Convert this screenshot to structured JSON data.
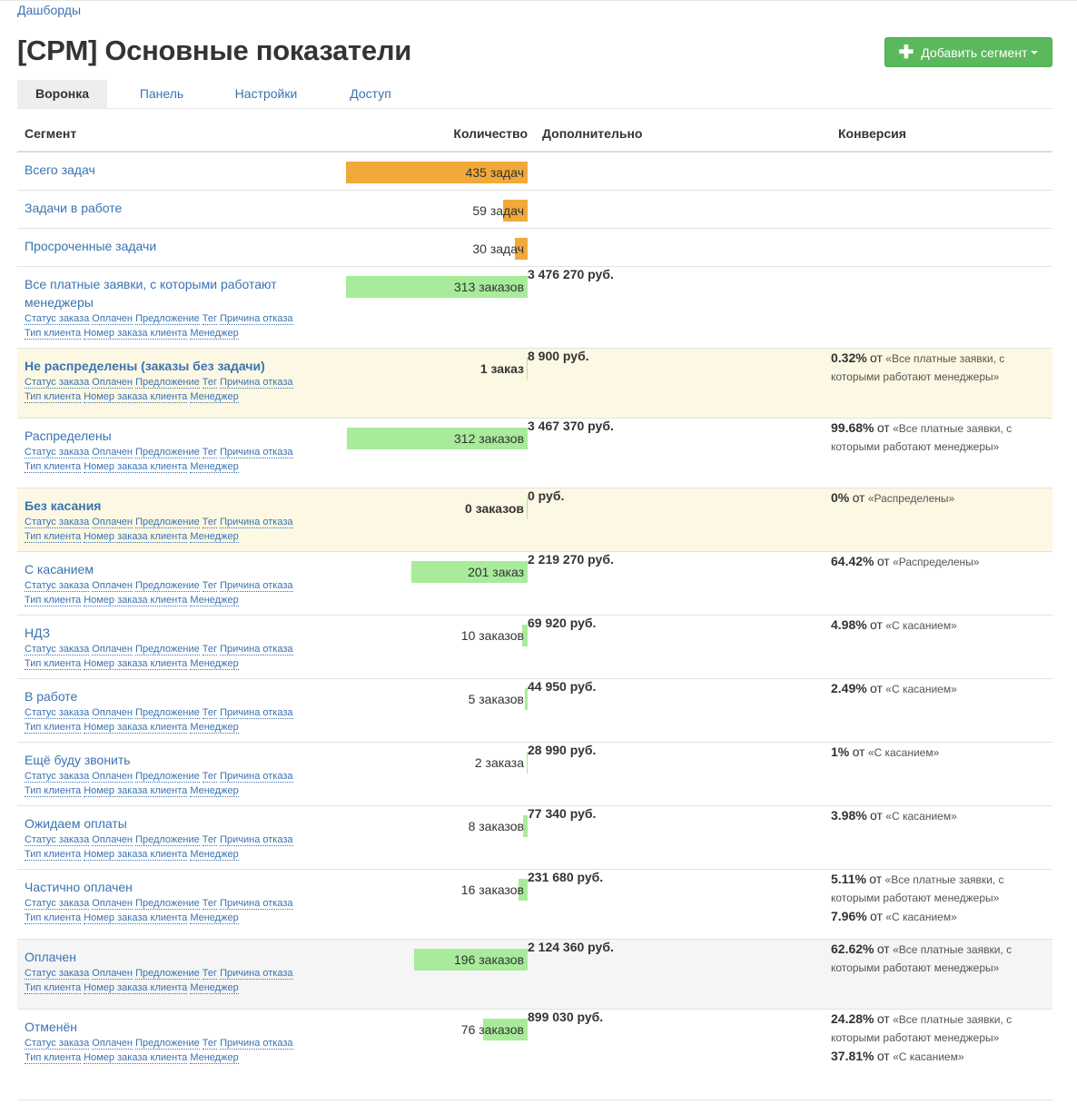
{
  "breadcrumb": "Дашборды",
  "title": "[CPM] Основные показатели",
  "add_segment_label": "Добавить сегмент",
  "tabs": [
    {
      "label": "Воронка",
      "active": true
    },
    {
      "label": "Панель",
      "active": false
    },
    {
      "label": "Настройки",
      "active": false
    },
    {
      "label": "Доступ",
      "active": false
    }
  ],
  "columns": {
    "segment": "Сегмент",
    "quantity": "Количество",
    "additional": "Дополнительно",
    "conversion": "Конверсия"
  },
  "filter_lines": [
    [
      "Статус заказа",
      "Оплачен",
      "Предложение",
      "Тег",
      "Причина отказа"
    ],
    [
      "Тип клиента",
      "Номер заказа клиента",
      "Менеджер"
    ]
  ],
  "colors": {
    "link": "#3a73b3",
    "orange_bar": "#f0a93a",
    "green_bar": "#a8eb9a",
    "highlight_row": "#fcf8e3",
    "grey_row": "#f5f5f5",
    "button": "#5cb85c"
  },
  "conversion_from_word": "от",
  "rows": [
    {
      "name": "Всего задач",
      "qty": "435 задач",
      "bar_fraction": 1.0,
      "bar_color": "orange",
      "sum": "",
      "conversion": [],
      "filters": false,
      "bold": false,
      "row_style": "normal"
    },
    {
      "name": "Задачи в работе",
      "qty": "59 задач",
      "bar_fraction": 0.136,
      "bar_color": "orange",
      "sum": "",
      "conversion": [],
      "filters": false,
      "bold": false,
      "row_style": "normal"
    },
    {
      "name": "Просроченные задачи",
      "qty": "30 задач",
      "bar_fraction": 0.069,
      "bar_color": "orange",
      "sum": "",
      "conversion": [],
      "filters": false,
      "bold": false,
      "row_style": "normal"
    },
    {
      "name": "Все платные заявки, с которыми работают менеджеры",
      "qty": "313 заказов",
      "bar_fraction": 1.0,
      "bar_color": "green",
      "sum": "3 476 270 руб.",
      "conversion": [],
      "filters": true,
      "bold": false,
      "row_style": "normal"
    },
    {
      "name": "Не распределены (заказы без задачи)",
      "qty": "1 заказ",
      "bar_fraction": 0.003,
      "bar_color": "green",
      "sum": "8 900 руб.",
      "conversion": [
        {
          "pct": "0.32%",
          "ref": "«Все платные заявки, с которыми работают менеджеры»"
        }
      ],
      "filters": true,
      "bold": true,
      "row_style": "highlight"
    },
    {
      "name": "Распределены",
      "qty": "312 заказов",
      "bar_fraction": 0.997,
      "bar_color": "green",
      "sum": "3 467 370 руб.",
      "conversion": [
        {
          "pct": "99.68%",
          "ref": "«Все платные заявки, с которыми работают менеджеры»"
        }
      ],
      "filters": true,
      "bold": false,
      "row_style": "normal"
    },
    {
      "name": "Без касания",
      "qty": "0 заказов",
      "bar_fraction": 0,
      "bar_color": "green",
      "sum": "0 руб.",
      "conversion": [
        {
          "pct": "0%",
          "ref": "«Распределены»"
        }
      ],
      "filters": true,
      "bold": true,
      "row_style": "highlight"
    },
    {
      "name": "С касанием",
      "qty": "201 заказ",
      "bar_fraction": 0.642,
      "bar_color": "green",
      "sum": "2 219 270 руб.",
      "conversion": [
        {
          "pct": "64.42%",
          "ref": "«Распределены»"
        }
      ],
      "filters": true,
      "bold": false,
      "row_style": "normal"
    },
    {
      "name": "НДЗ",
      "qty": "10 заказов",
      "bar_fraction": 0.032,
      "bar_color": "green",
      "sum": "69 920 руб.",
      "conversion": [
        {
          "pct": "4.98%",
          "ref": "«С касанием»"
        }
      ],
      "filters": true,
      "bold": false,
      "row_style": "normal"
    },
    {
      "name": "В работе",
      "qty": "5 заказов",
      "bar_fraction": 0.016,
      "bar_color": "green",
      "sum": "44 950 руб.",
      "conversion": [
        {
          "pct": "2.49%",
          "ref": "«С касанием»"
        }
      ],
      "filters": true,
      "bold": false,
      "row_style": "normal"
    },
    {
      "name": "Ещё буду звонить",
      "qty": "2 заказа",
      "bar_fraction": 0.006,
      "bar_color": "green",
      "sum": "28 990 руб.",
      "conversion": [
        {
          "pct": "1%",
          "ref": "«С касанием»"
        }
      ],
      "filters": true,
      "bold": false,
      "row_style": "normal"
    },
    {
      "name": "Ожидаем оплаты",
      "qty": "8 заказов",
      "bar_fraction": 0.026,
      "bar_color": "green",
      "sum": "77 340 руб.",
      "conversion": [
        {
          "pct": "3.98%",
          "ref": "«С касанием»"
        }
      ],
      "filters": true,
      "bold": false,
      "row_style": "normal"
    },
    {
      "name": "Частично оплачен",
      "qty": "16 заказов",
      "bar_fraction": 0.051,
      "bar_color": "green",
      "sum": "231 680 руб.",
      "conversion": [
        {
          "pct": "5.11%",
          "ref": "«Все платные заявки, с которыми работают менеджеры»"
        },
        {
          "pct": "7.96%",
          "ref": "«С касанием»"
        }
      ],
      "filters": true,
      "bold": false,
      "row_style": "normal"
    },
    {
      "name": "Оплачен",
      "qty": "196 заказов",
      "bar_fraction": 0.626,
      "bar_color": "green",
      "sum": "2 124 360 руб.",
      "conversion": [
        {
          "pct": "62.62%",
          "ref": "«Все платные заявки, с которыми работают менеджеры»"
        }
      ],
      "filters": true,
      "bold": false,
      "row_style": "grey"
    },
    {
      "name": "Отменён",
      "qty": "76 заказов",
      "bar_fraction": 0.243,
      "bar_color": "green",
      "sum": "899 030 руб.",
      "conversion": [
        {
          "pct": "24.28%",
          "ref": "«Все платные заявки, с которыми работают менеджеры»"
        },
        {
          "pct": "37.81%",
          "ref": "«С касанием»"
        }
      ],
      "filters": true,
      "bold": false,
      "row_style": "normal"
    }
  ]
}
